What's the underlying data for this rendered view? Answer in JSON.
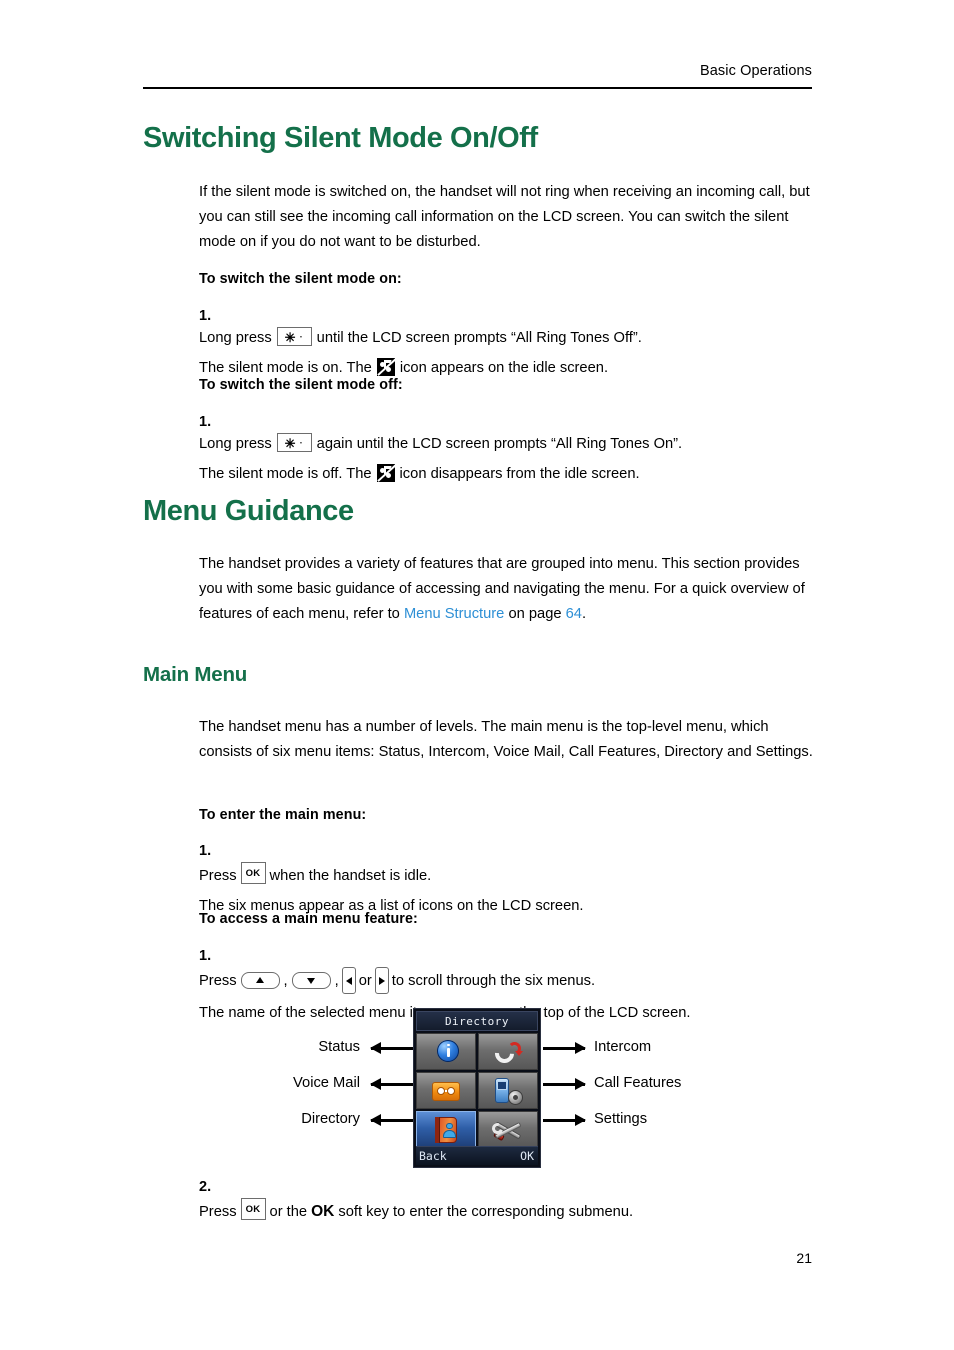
{
  "header": {
    "running_title": "Basic Operations"
  },
  "sections": [
    {
      "heading": "Switching Silent Mode On/Off",
      "intro": "If the silent mode is switched on, the handset will not ring when receiving an incoming call, but you can still see the incoming call information on the LCD screen. You can switch the silent mode on if you do not want to be disturbed.",
      "lead_on": "To switch the silent mode on:",
      "step_on_num": "1.",
      "step_on_a1": "Long press",
      "step_on_a2": "until the LCD screen prompts “All Ring Tones Off”.",
      "step_on_b1": "The silent mode is on. The",
      "step_on_b2": "icon appears on the idle screen.",
      "lead_off": "To switch the silent mode off:",
      "step_off_num": "1.",
      "step_off_a1": "Long press",
      "step_off_a2": "again until the LCD screen prompts “All Ring Tones On”.",
      "step_off_b1": "The silent mode is off. The",
      "step_off_b2": "icon disappears from the idle screen."
    },
    {
      "heading": "Menu Guidance",
      "intro_a": "The handset provides a variety of features that are grouped into menu. This section provides you with some basic guidance of accessing and navigating the menu. For a quick overview of features of each menu, refer to ",
      "link_text": "Menu Structure",
      "intro_b": " on page ",
      "link_page": "64",
      "intro_c": "."
    },
    {
      "heading": "Main Menu",
      "intro": "The handset menu has a number of levels. The main menu is the top-level menu, which consists of six menu items: Status, Intercom, Voice Mail, Call Features, Directory and Settings.",
      "lead_enter": "To enter the main menu:",
      "step1_num": "1.",
      "step1_a1": "Press",
      "step1_a2": "when the handset is idle.",
      "step1_b": "The six menus appear as a list of icons on the LCD screen.",
      "lead_access": "To access a main menu feature:",
      "step_access_num": "1.",
      "step_access_a1": "Press",
      "step_access_sep1": ",",
      "step_access_sep2": ",",
      "step_access_or": "or",
      "step_access_a2": "to scroll through the six menus.",
      "step_access_b": "The name of the selected menu item appears on the top of the LCD screen.",
      "step2_num": "2.",
      "step2_a1": "Press",
      "step2_a2": "or the",
      "step2_ok": "OK",
      "step2_a3": "soft key to enter the corresponding submenu."
    }
  ],
  "keys": {
    "star_glyph": "✳",
    "star_mark": "ᐧ",
    "ok_label": "OK"
  },
  "lcd": {
    "title": "Directory",
    "softkey_left": "Back",
    "softkey_right": "OK",
    "cells": [
      {
        "name": "Status",
        "icon": "info-icon",
        "selected": false
      },
      {
        "name": "Intercom",
        "icon": "handset-arrow-icon",
        "selected": false
      },
      {
        "name": "Voice Mail",
        "icon": "voicemail-icon",
        "selected": false
      },
      {
        "name": "Call Features",
        "icon": "phone-gear-icon",
        "selected": false
      },
      {
        "name": "Directory",
        "icon": "address-book-icon",
        "selected": true
      },
      {
        "name": "Settings",
        "icon": "wrench-screwdriver-icon",
        "selected": false
      }
    ]
  },
  "callouts": {
    "left": [
      "Status",
      "Voice Mail",
      "Directory"
    ],
    "right": [
      "Intercom",
      "Call Features",
      "Settings"
    ]
  },
  "footer": {
    "page_number": "21"
  },
  "colors": {
    "heading_green": "#14704a",
    "link_blue": "#2d8fd5",
    "lcd_selected": "#2f5fa8"
  }
}
